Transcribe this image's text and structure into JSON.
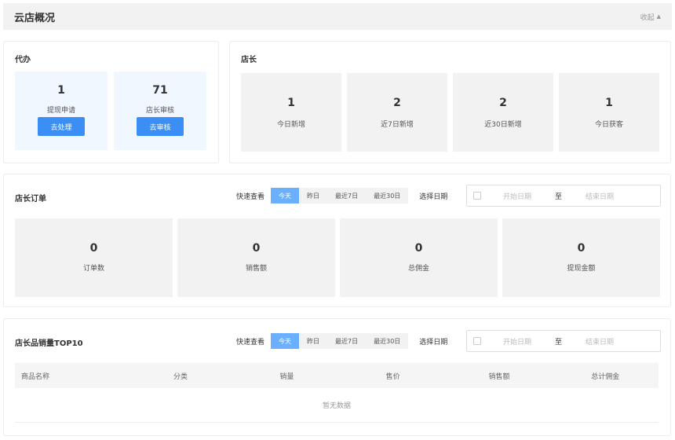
{
  "header": {
    "title": "云店概况",
    "collapse_label": "收起"
  },
  "todo": {
    "title": "代办",
    "cards": [
      {
        "value": "1",
        "label": "提现申请",
        "button": "去处理"
      },
      {
        "value": "71",
        "label": "店长审核",
        "button": "去审核"
      }
    ]
  },
  "manager": {
    "title": "店长",
    "stats": [
      {
        "value": "1",
        "label": "今日新增"
      },
      {
        "value": "2",
        "label": "近7日新增"
      },
      {
        "value": "2",
        "label": "近30日新增"
      },
      {
        "value": "1",
        "label": "今日获客"
      }
    ]
  },
  "orders": {
    "title": "店长订单",
    "quick_label": "快速查看",
    "quick_options": [
      "今天",
      "昨日",
      "最近7日",
      "最近30日"
    ],
    "active_option": "今天",
    "date_label": "选择日期",
    "start_placeholder": "开始日期",
    "to_label": "至",
    "end_placeholder": "结束日期",
    "stats": [
      {
        "value": "0",
        "label": "订单数"
      },
      {
        "value": "0",
        "label": "销售额"
      },
      {
        "value": "0",
        "label": "总佣金"
      },
      {
        "value": "0",
        "label": "提现金额"
      }
    ]
  },
  "top10": {
    "title": "店长品销量TOP10",
    "quick_label": "快速查看",
    "quick_options": [
      "今天",
      "昨日",
      "最近7日",
      "最近30日"
    ],
    "active_option": "今天",
    "date_label": "选择日期",
    "start_placeholder": "开始日期",
    "to_label": "至",
    "end_placeholder": "结束日期",
    "columns": [
      "商品名称",
      "分类",
      "销量",
      "售价",
      "销售额",
      "总计佣金"
    ],
    "empty_text": "暂无数据"
  },
  "colors": {
    "accent": "#3b8ff4",
    "active_tab": "#6ab0ff",
    "card_blue": "#f0f7ff",
    "card_gray": "#f2f2f2"
  }
}
